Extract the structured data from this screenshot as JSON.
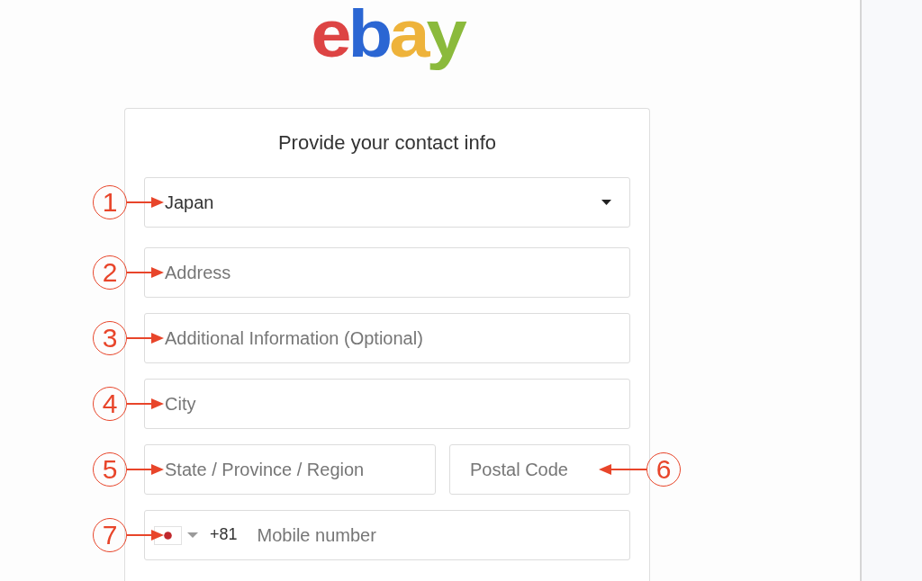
{
  "logo": {
    "letters": [
      {
        "char": "e",
        "color": "#dd4444"
      },
      {
        "char": "b",
        "color": "#2b66d3"
      },
      {
        "char": "a",
        "color": "#eeb33b"
      },
      {
        "char": "y",
        "color": "#8bba3c"
      }
    ]
  },
  "form": {
    "title": "Provide your contact info",
    "rows": [
      {
        "fields": [
          {
            "kind": "select",
            "value": "Japan",
            "callout": {
              "number": "1",
              "points_left": false
            }
          }
        ]
      },
      {
        "fields": [
          {
            "kind": "text",
            "placeholder": "Address",
            "callout": {
              "number": "2",
              "points_left": false
            }
          }
        ]
      },
      {
        "fields": [
          {
            "kind": "text",
            "placeholder": "Additional Information (Optional)",
            "callout": {
              "number": "3",
              "points_left": false
            }
          }
        ]
      },
      {
        "fields": [
          {
            "kind": "text",
            "placeholder": "City",
            "callout": {
              "number": "4",
              "points_left": false
            }
          }
        ]
      },
      {
        "fields": [
          {
            "kind": "text",
            "placeholder": "State / Province / Region",
            "callout": {
              "number": "5",
              "points_left": false
            }
          },
          {
            "kind": "text",
            "placeholder": "Postal Code",
            "callout": {
              "number": "6",
              "points_left": true
            }
          }
        ]
      },
      {
        "fields": [
          {
            "kind": "phone",
            "country_code": "+81",
            "placeholder": "Mobile number",
            "callout": {
              "number": "7",
              "points_left": false
            }
          }
        ]
      }
    ]
  }
}
